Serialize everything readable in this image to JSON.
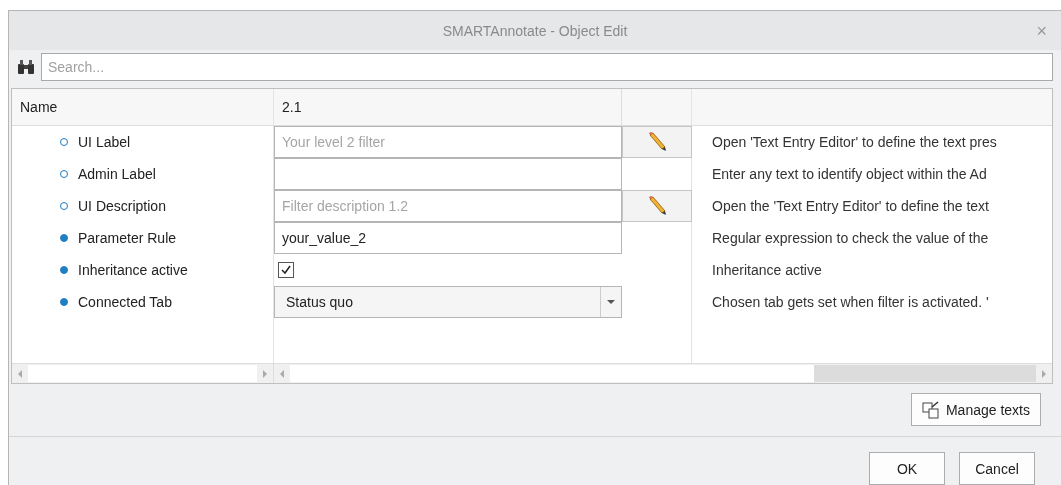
{
  "window": {
    "title": "SMARTAnnotate - Object Edit",
    "close": "×"
  },
  "search": {
    "placeholder": "Search..."
  },
  "table": {
    "columns": [
      "Name",
      "2.1"
    ],
    "rows": [
      {
        "name": "UI Label",
        "dot_filled": false,
        "kind": "text",
        "placeholder": "Your level 2 filter",
        "edit_button": true,
        "description": "Open 'Text Entry Editor' to define the text pres"
      },
      {
        "name": "Admin Label",
        "dot_filled": false,
        "kind": "text",
        "edit_button": false,
        "description": "Enter any text to identify object within the Ad"
      },
      {
        "name": "UI Description",
        "dot_filled": false,
        "kind": "text",
        "placeholder": "Filter description 1.2",
        "edit_button": true,
        "description": "Open the 'Text Entry Editor' to define the text"
      },
      {
        "name": "Parameter Rule",
        "dot_filled": true,
        "kind": "text",
        "value": "your_value_2",
        "edit_button": false,
        "description": "Regular expression to check the value of the"
      },
      {
        "name": "Inheritance active",
        "dot_filled": true,
        "kind": "checkbox",
        "checked": true,
        "edit_button": false,
        "description": "Inheritance active"
      },
      {
        "name": "Connected Tab",
        "dot_filled": true,
        "kind": "dropdown",
        "value": "Status quo",
        "edit_button": false,
        "description": "Chosen tab gets set when filter is activated. '"
      }
    ]
  },
  "manage_button": "Manage texts",
  "buttons": [
    "OK",
    "Cancel"
  ]
}
